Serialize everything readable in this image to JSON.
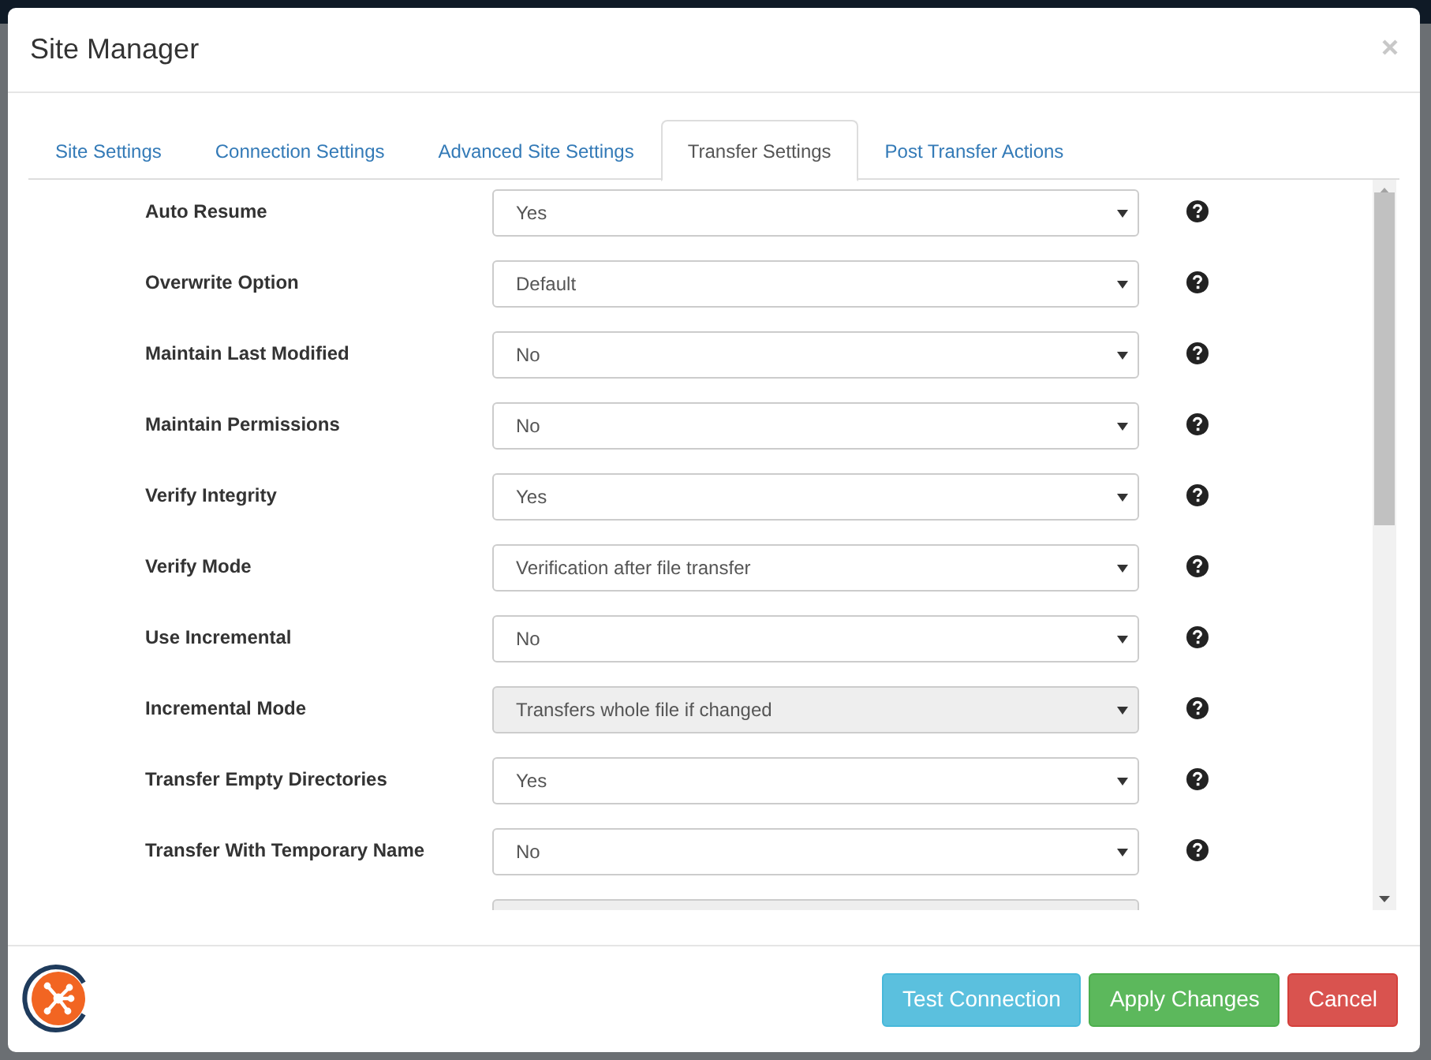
{
  "window": {
    "title": "Site Manager"
  },
  "tabs": [
    {
      "label": "Site Settings",
      "selected": false
    },
    {
      "label": "Connection Settings",
      "selected": false
    },
    {
      "label": "Advanced Site Settings",
      "selected": false
    },
    {
      "label": "Transfer Settings",
      "selected": true
    },
    {
      "label": "Post Transfer Actions",
      "selected": false
    }
  ],
  "settings": [
    {
      "label": "Auto Resume",
      "value": "Yes",
      "disabled": false
    },
    {
      "label": "Overwrite Option",
      "value": "Default",
      "disabled": false
    },
    {
      "label": "Maintain Last Modified",
      "value": "No",
      "disabled": false
    },
    {
      "label": "Maintain Permissions",
      "value": "No",
      "disabled": false
    },
    {
      "label": "Verify Integrity",
      "value": "Yes",
      "disabled": false
    },
    {
      "label": "Verify Mode",
      "value": "Verification after file transfer",
      "disabled": false
    },
    {
      "label": "Use Incremental",
      "value": "No",
      "disabled": false
    },
    {
      "label": "Incremental Mode",
      "value": "Transfers whole file if changed",
      "disabled": true
    },
    {
      "label": "Transfer Empty Directories",
      "value": "Yes",
      "disabled": false
    },
    {
      "label": "Transfer With Temporary Name",
      "value": "No",
      "disabled": false
    },
    {
      "disabled": true
    }
  ],
  "footer_buttons": [
    {
      "label": "Test Connection",
      "kind": "info"
    },
    {
      "label": "Apply Changes",
      "kind": "success"
    },
    {
      "label": "Cancel",
      "kind": "danger"
    }
  ]
}
